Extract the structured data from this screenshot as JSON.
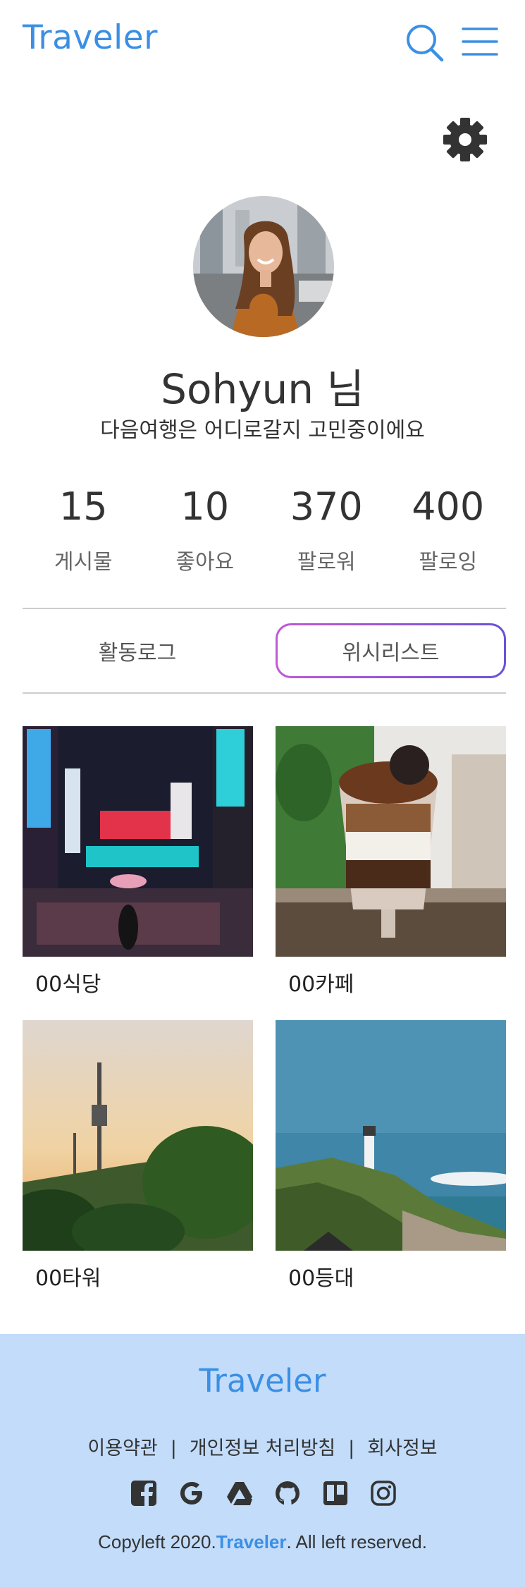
{
  "header": {
    "logo": "Traveler",
    "search_icon": "search-icon",
    "menu_icon": "hamburger-menu-icon"
  },
  "settings_icon": "gear-icon",
  "profile": {
    "name": "Sohyun 님",
    "bio": "다음여행은 어디로갈지 고민중이에요",
    "stats": [
      {
        "value": "15",
        "label": "게시물"
      },
      {
        "value": "10",
        "label": "좋아요"
      },
      {
        "value": "370",
        "label": "팔로워"
      },
      {
        "value": "400",
        "label": "팔로잉"
      }
    ]
  },
  "tabs": [
    {
      "label": "활동로그",
      "active": false
    },
    {
      "label": "위시리스트",
      "active": true
    }
  ],
  "wishlist": [
    {
      "caption": "00식당"
    },
    {
      "caption": "00카페"
    },
    {
      "caption": "00타워"
    },
    {
      "caption": "00등대"
    }
  ],
  "footer": {
    "logo": "Traveler",
    "links": [
      "이용약관",
      "개인정보 처리방침",
      "회사정보"
    ],
    "separator": "|",
    "socials": [
      "facebook-icon",
      "google-icon",
      "google-drive-icon",
      "github-icon",
      "trello-icon",
      "instagram-icon"
    ],
    "copyright_prefix": "Copyleft 2020.",
    "copyright_brand": "Traveler",
    "copyright_suffix": ". All left reserved."
  },
  "colors": {
    "brand": "#3b8fe4",
    "footer_bg": "#c2dcfa",
    "tab_border_start": "#c05ad6",
    "tab_border_end": "#6a52d8"
  }
}
